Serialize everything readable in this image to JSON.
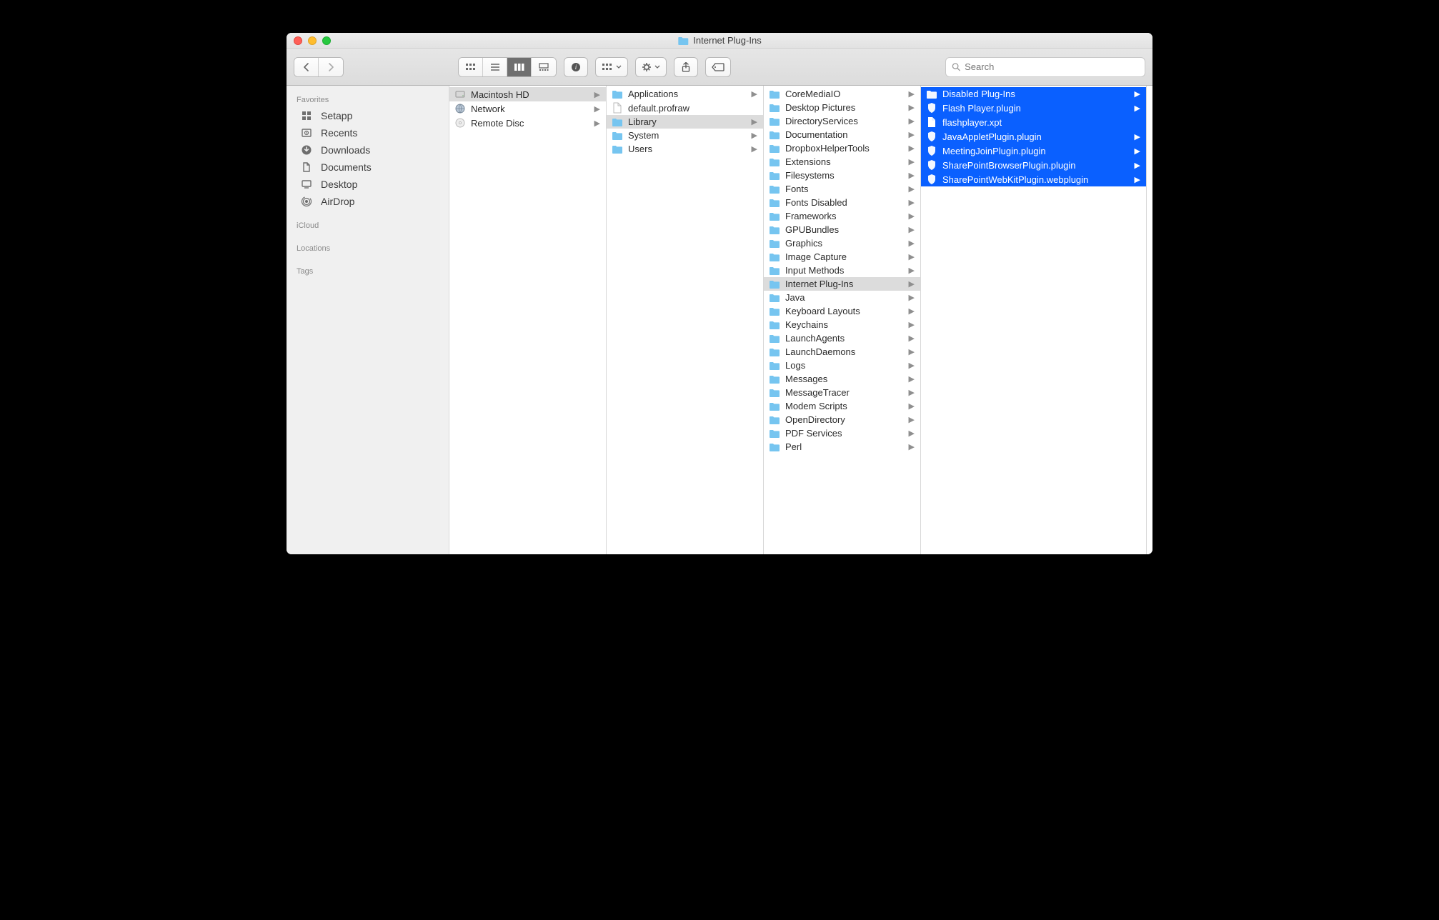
{
  "window_title": "Internet Plug-Ins",
  "search_placeholder": "Search",
  "sidebar": {
    "sections": [
      {
        "title": "Favorites",
        "items": [
          {
            "icon": "grid",
            "label": "Setapp"
          },
          {
            "icon": "clock",
            "label": "Recents"
          },
          {
            "icon": "download",
            "label": "Downloads"
          },
          {
            "icon": "doc",
            "label": "Documents"
          },
          {
            "icon": "desktop",
            "label": "Desktop"
          },
          {
            "icon": "airdrop",
            "label": "AirDrop"
          }
        ]
      },
      {
        "title": "iCloud",
        "items": []
      },
      {
        "title": "Locations",
        "items": []
      },
      {
        "title": "Tags",
        "items": []
      }
    ]
  },
  "columns": [
    {
      "items": [
        {
          "icon": "hd",
          "label": "Macintosh HD",
          "children": true,
          "selected": "gray"
        },
        {
          "icon": "globe",
          "label": "Network",
          "children": true
        },
        {
          "icon": "disc",
          "label": "Remote Disc",
          "children": true
        }
      ]
    },
    {
      "items": [
        {
          "icon": "folder-app",
          "label": "Applications",
          "children": true
        },
        {
          "icon": "file",
          "label": "default.profraw",
          "children": false
        },
        {
          "icon": "folder-sys",
          "label": "Library",
          "children": true,
          "selected": "gray"
        },
        {
          "icon": "folder-sys",
          "label": "System",
          "children": true
        },
        {
          "icon": "folder",
          "label": "Users",
          "children": true
        }
      ]
    },
    {
      "items": [
        {
          "icon": "folder",
          "label": "CoreMediaIO",
          "children": true
        },
        {
          "icon": "folder",
          "label": "Desktop Pictures",
          "children": true
        },
        {
          "icon": "folder",
          "label": "DirectoryServices",
          "children": true
        },
        {
          "icon": "folder",
          "label": "Documentation",
          "children": true
        },
        {
          "icon": "folder",
          "label": "DropboxHelperTools",
          "children": true
        },
        {
          "icon": "folder",
          "label": "Extensions",
          "children": true
        },
        {
          "icon": "folder",
          "label": "Filesystems",
          "children": true
        },
        {
          "icon": "folder",
          "label": "Fonts",
          "children": true
        },
        {
          "icon": "folder",
          "label": "Fonts Disabled",
          "children": true
        },
        {
          "icon": "folder",
          "label": "Frameworks",
          "children": true
        },
        {
          "icon": "folder",
          "label": "GPUBundles",
          "children": true
        },
        {
          "icon": "folder",
          "label": "Graphics",
          "children": true
        },
        {
          "icon": "folder",
          "label": "Image Capture",
          "children": true
        },
        {
          "icon": "folder",
          "label": "Input Methods",
          "children": true
        },
        {
          "icon": "folder",
          "label": "Internet Plug-Ins",
          "children": true,
          "selected": "gray"
        },
        {
          "icon": "folder",
          "label": "Java",
          "children": true
        },
        {
          "icon": "folder",
          "label": "Keyboard Layouts",
          "children": true
        },
        {
          "icon": "folder",
          "label": "Keychains",
          "children": true
        },
        {
          "icon": "folder",
          "label": "LaunchAgents",
          "children": true
        },
        {
          "icon": "folder",
          "label": "LaunchDaemons",
          "children": true
        },
        {
          "icon": "folder",
          "label": "Logs",
          "children": true
        },
        {
          "icon": "folder",
          "label": "Messages",
          "children": true
        },
        {
          "icon": "folder",
          "label": "MessageTracer",
          "children": true
        },
        {
          "icon": "folder",
          "label": "Modem Scripts",
          "children": true
        },
        {
          "icon": "folder",
          "label": "OpenDirectory",
          "children": true
        },
        {
          "icon": "folder",
          "label": "PDF Services",
          "children": true
        },
        {
          "icon": "folder",
          "label": "Perl",
          "children": true
        }
      ]
    },
    {
      "items": [
        {
          "icon": "folder",
          "label": "Disabled Plug-Ins",
          "children": true,
          "selected": "blue"
        },
        {
          "icon": "plugin",
          "label": "Flash Player.plugin",
          "children": true,
          "selected": "blue"
        },
        {
          "icon": "file-white",
          "label": "flashplayer.xpt",
          "children": false,
          "selected": "blue"
        },
        {
          "icon": "plugin",
          "label": "JavaAppletPlugin.plugin",
          "children": true,
          "selected": "blue"
        },
        {
          "icon": "plugin",
          "label": "MeetingJoinPlugin.plugin",
          "children": true,
          "selected": "blue"
        },
        {
          "icon": "plugin",
          "label": "SharePointBrowserPlugin.plugin",
          "children": true,
          "selected": "blue"
        },
        {
          "icon": "plugin",
          "label": "SharePointWebKitPlugin.webplugin",
          "children": true,
          "selected": "blue"
        }
      ]
    }
  ]
}
